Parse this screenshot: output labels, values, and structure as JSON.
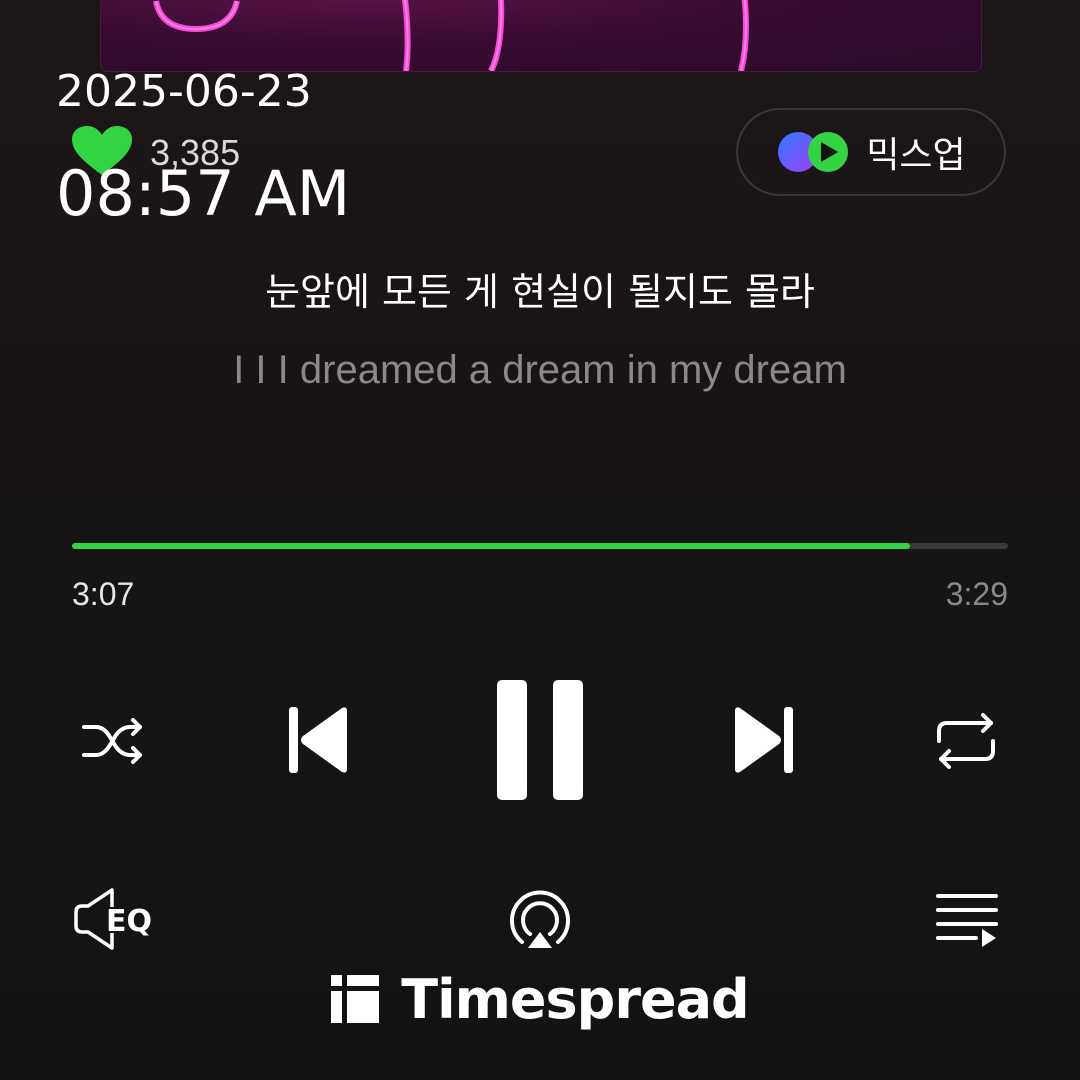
{
  "stamp": {
    "date": "2025-06-23",
    "time": "08:57 AM"
  },
  "like": {
    "icon": "heart-icon",
    "count": "3,385",
    "color": "#33d444"
  },
  "mixup": {
    "label": "믹스업",
    "icon": "mixup-icon"
  },
  "lyrics": {
    "current": "눈앞에 모든 게 현실이 될지도 몰라",
    "next": "I I I dreamed a dream in my dream"
  },
  "playback": {
    "elapsed": "3:07",
    "total": "3:29",
    "progress_fraction": 0.895,
    "accent": "#33d444"
  },
  "controls": {
    "shuffle": "shuffle-icon",
    "previous": "skip-previous-icon",
    "play_pause": "pause-icon",
    "next": "skip-next-icon",
    "repeat": "repeat-icon",
    "equalizer": "equalizer-icon",
    "cast": "cast-icon",
    "playlist": "playlist-icon"
  },
  "watermark": {
    "text": "Timespread",
    "icon": "timespread-logo-icon"
  }
}
